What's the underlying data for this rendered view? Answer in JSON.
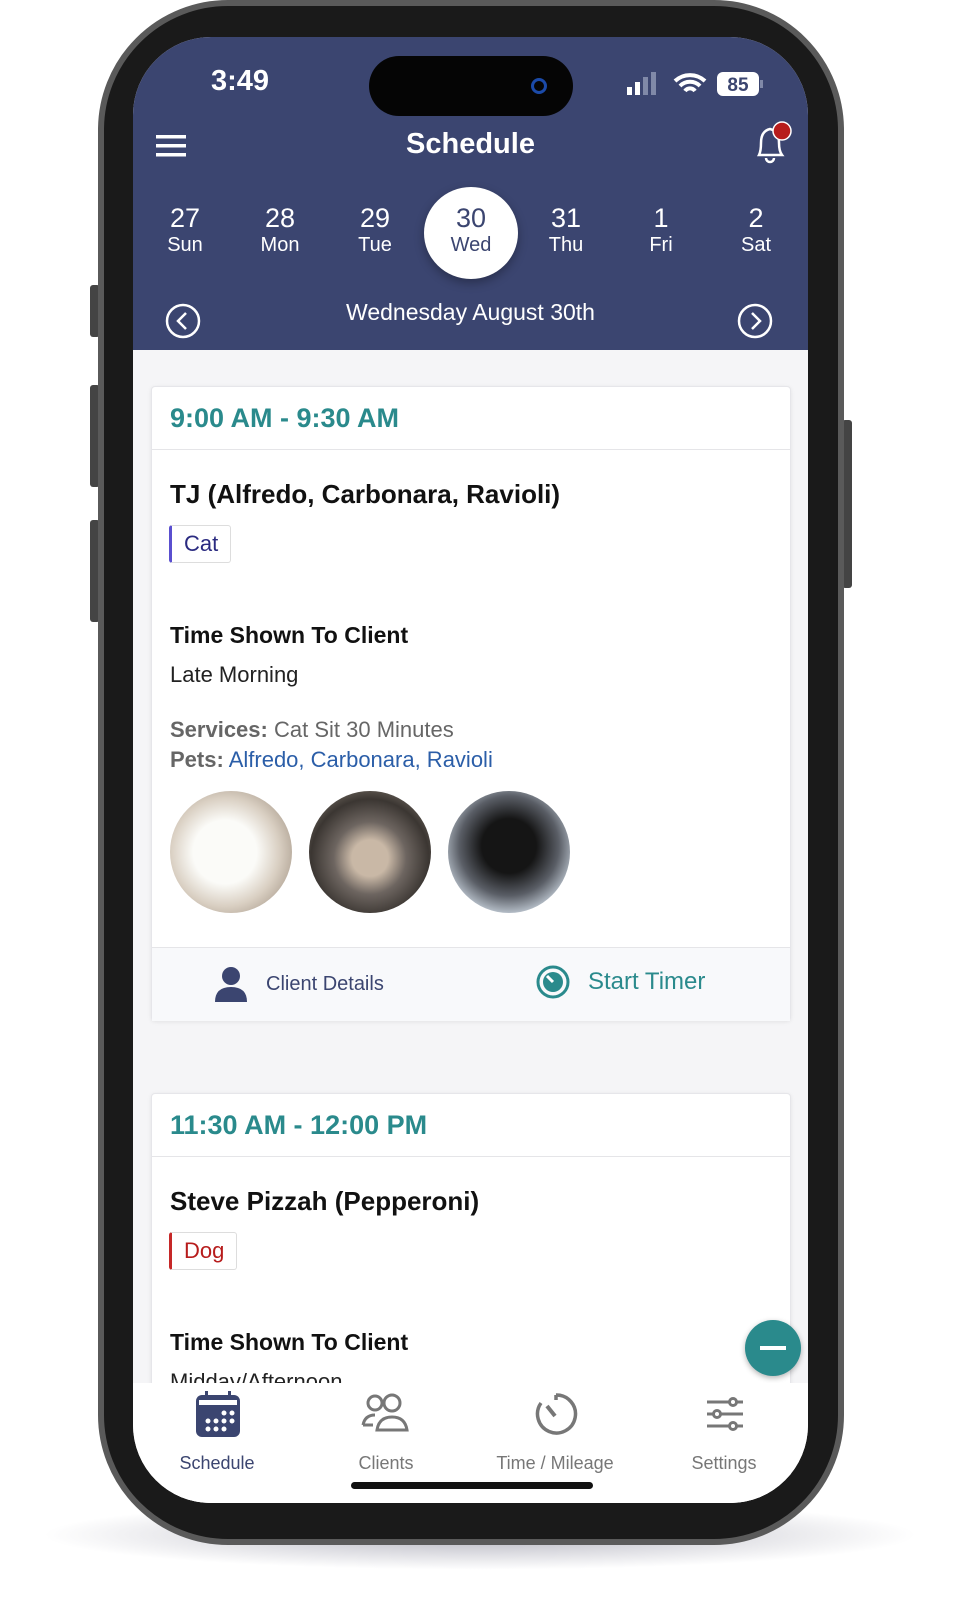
{
  "status_bar": {
    "time": "3:49",
    "battery": "85"
  },
  "header": {
    "title": "Schedule",
    "has_notification": true
  },
  "week": [
    {
      "num": "27",
      "day": "Sun"
    },
    {
      "num": "28",
      "day": "Mon"
    },
    {
      "num": "29",
      "day": "Tue"
    },
    {
      "num": "30",
      "day": "Wed",
      "selected": true
    },
    {
      "num": "31",
      "day": "Thu"
    },
    {
      "num": "1",
      "day": "Fri"
    },
    {
      "num": "2",
      "day": "Sat"
    }
  ],
  "selected_date": "Wednesday August 30th",
  "appointments": [
    {
      "time": "9:00 AM - 9:30 AM",
      "client": "TJ  (Alfredo, Carbonara, Ravioli)",
      "tag": "Cat",
      "tag_color": "#5a4fcf",
      "time_shown_label": "Time Shown To Client",
      "time_shown": "Late Morning",
      "services_label": "Services:",
      "services": "Cat Sit 30 Minutes",
      "pets_label": "Pets:",
      "pets": "Alfredo, Carbonara, Ravioli",
      "client_details": "Client Details",
      "start_timer": "Start Timer"
    },
    {
      "time": "11:30 AM - 12:00 PM",
      "client": "Steve Pizzah (Pepperoni)",
      "tag": "Dog",
      "tag_color": "#c62828",
      "time_shown_label": "Time Shown To Client",
      "time_shown": "Midday/Afternoon"
    }
  ],
  "tabs": [
    {
      "label": "Schedule",
      "active": true
    },
    {
      "label": "Clients"
    },
    {
      "label": "Time / Mileage"
    },
    {
      "label": "Settings"
    }
  ],
  "colors": {
    "header": "#3b4570",
    "accent": "#2a8a8c",
    "link": "#2b5ea8"
  }
}
